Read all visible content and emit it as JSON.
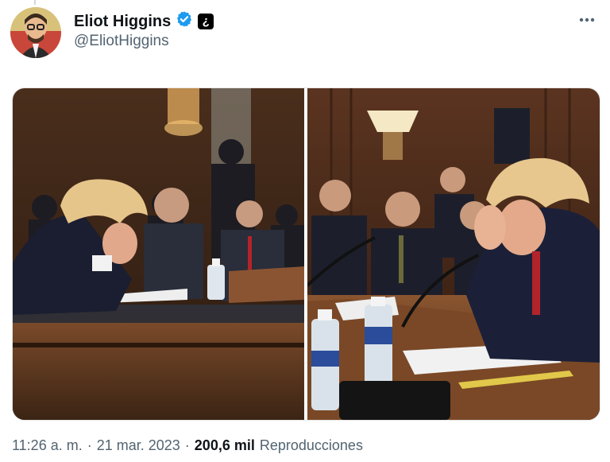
{
  "tweet": {
    "display_name": "Eliot Higgins",
    "handle": "@EliotHiggins",
    "label_glyph": "¿",
    "time": "11:26 a. m.",
    "separator": "·",
    "date": "21 mar. 2023",
    "views_count": "200,6 mil",
    "views_label": "Reproducciones"
  },
  "icons": {
    "verified": "verified-badge-icon",
    "more": "more-options-icon"
  },
  "colors": {
    "verified_blue": "#1d9bf0",
    "secondary_text": "#536471"
  }
}
